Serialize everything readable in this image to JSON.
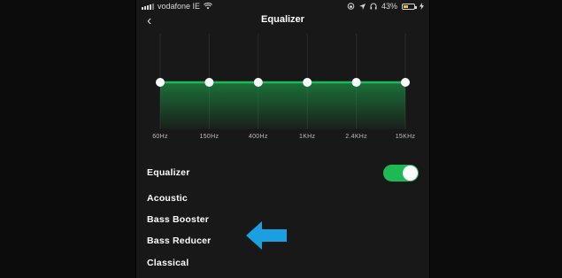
{
  "status_bar": {
    "carrier": "vodafone IE",
    "battery_percent": "43%",
    "battery_level": 0.43
  },
  "header": {
    "title": "Equalizer",
    "back_icon": "chevron-left-icon",
    "back_glyph": "‹"
  },
  "equalizer": {
    "bands": [
      {
        "label": "60Hz",
        "level": 0
      },
      {
        "label": "150Hz",
        "level": 0
      },
      {
        "label": "400Hz",
        "level": 0
      },
      {
        "label": "1KHz",
        "level": 0
      },
      {
        "label": "2.4KHz",
        "level": 0
      },
      {
        "label": "15KHz",
        "level": 0
      }
    ],
    "accent_color": "#1db954"
  },
  "settings": {
    "equalizer_label": "Equalizer",
    "equalizer_enabled": true
  },
  "presets": [
    "Acoustic",
    "Bass Booster",
    "Bass Reducer",
    "Classical"
  ],
  "annotation": {
    "icon": "arrow-left-icon",
    "color": "#1aa0e0"
  }
}
